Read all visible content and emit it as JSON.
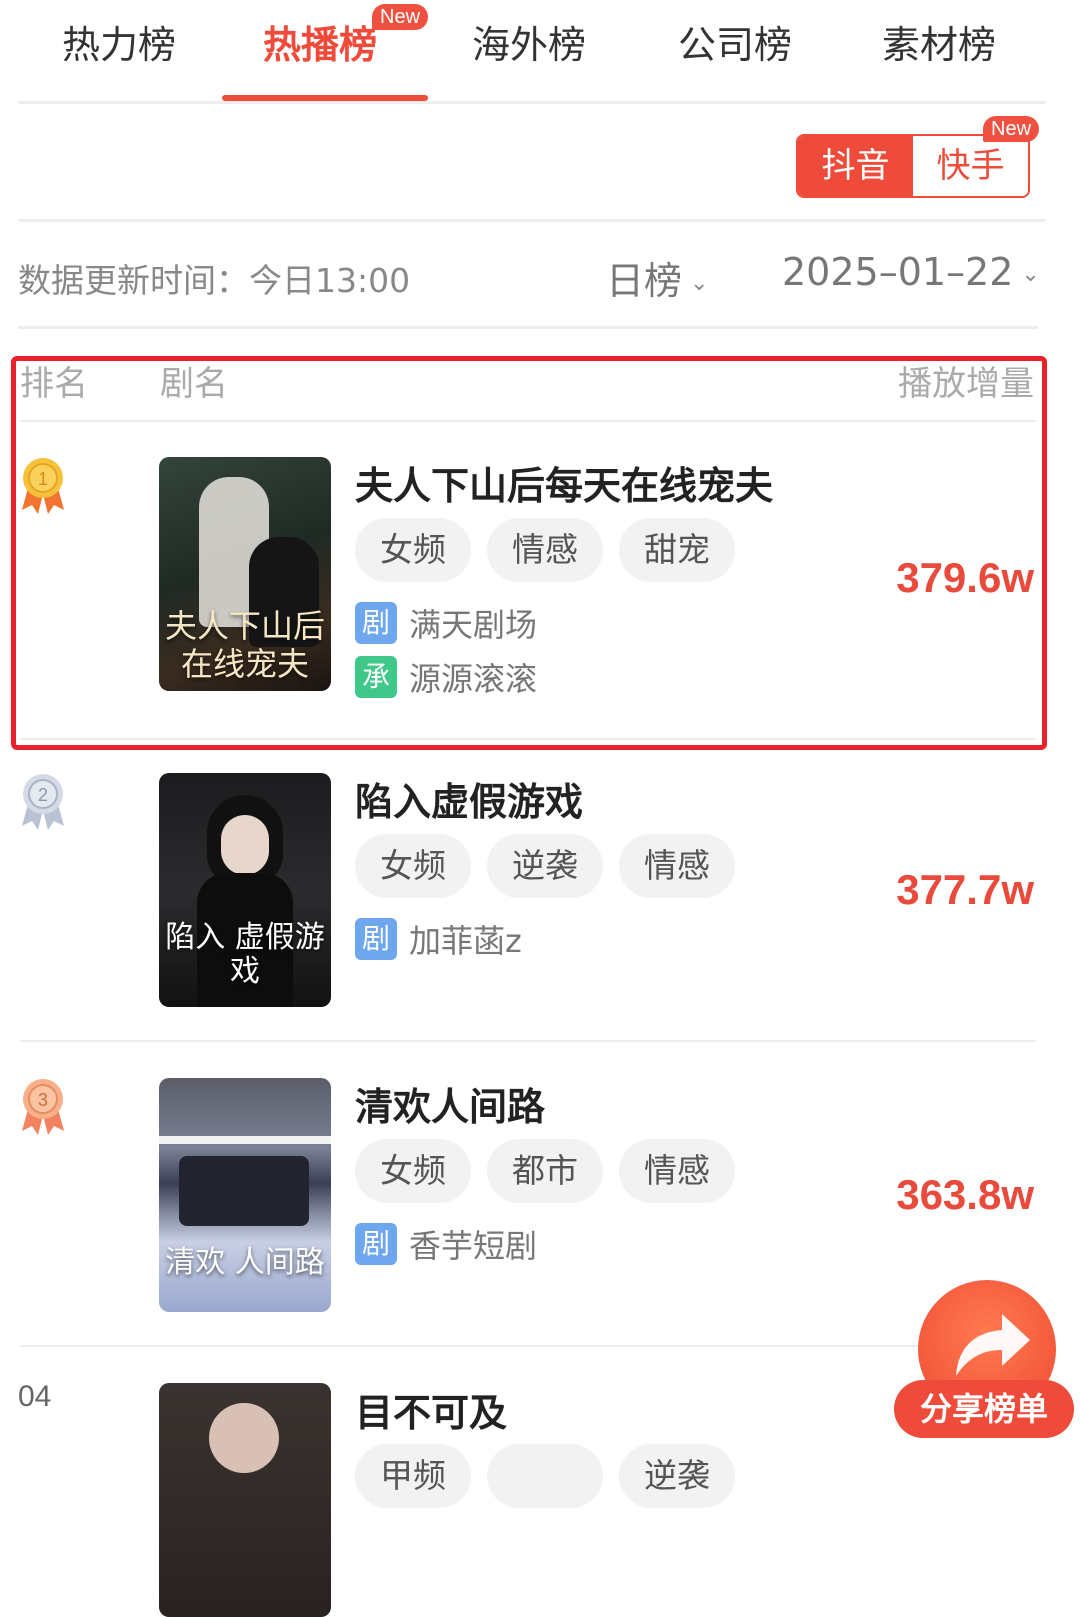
{
  "tabs": [
    {
      "label": "热力榜"
    },
    {
      "label": "热播榜",
      "badge": "New",
      "active": true
    },
    {
      "label": "海外榜"
    },
    {
      "label": "公司榜"
    },
    {
      "label": "素材榜"
    }
  ],
  "platform": {
    "options": [
      "抖音",
      "快手"
    ],
    "selected": "抖音",
    "kuaishou_badge": "New"
  },
  "filters": {
    "update_time": "数据更新时间：今日13:00",
    "period": "日榜",
    "date": "2025–01–22"
  },
  "table_header": {
    "rank": "排名",
    "name": "剧名",
    "plays": "播放增量"
  },
  "rows": [
    {
      "rank": "1",
      "title": "夫人下山后每天在线宠夫",
      "tags": [
        "女频",
        "情感",
        "甜宠"
      ],
      "producer_badge": "剧",
      "producer": "满天剧场",
      "contractor_badge": "承",
      "contractor": "源源滚滚",
      "value": "379.6w",
      "poster_text": "夫人下山后 在线宠夫",
      "medal": "gold",
      "highlighted": true
    },
    {
      "rank": "2",
      "title": "陷入虚假游戏",
      "tags": [
        "女频",
        "逆袭",
        "情感"
      ],
      "producer_badge": "剧",
      "producer": "加菲菡z",
      "value": "377.7w",
      "poster_text": "陷入 虚假游戏",
      "medal": "silver"
    },
    {
      "rank": "3",
      "title": "清欢人间路",
      "tags": [
        "女频",
        "都市",
        "情感"
      ],
      "producer_badge": "剧",
      "producer": "香芋短剧",
      "value": "363.8w",
      "poster_text": "清欢 人间路",
      "medal": "bronze"
    },
    {
      "rank": "04",
      "title": "目不可及",
      "tags": [
        "甲频",
        "",
        "逆袭"
      ]
    }
  ],
  "share": {
    "label": "分享榜单",
    "icon": "share-arrow-icon"
  },
  "colors": {
    "accent": "#ef4b3b",
    "value": "#e84a3c",
    "highlight_border": "#e8222a",
    "producer_badge": "#6ea7ee",
    "contractor_badge": "#3fc88a"
  }
}
